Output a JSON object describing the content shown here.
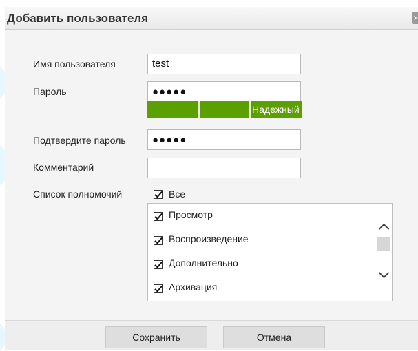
{
  "dialog": {
    "title": "Добавить пользователя",
    "close_glyph": "×"
  },
  "form": {
    "username_label": "Имя пользователя",
    "username_value": "test",
    "password_label": "Пароль",
    "password_value": "●●●●●",
    "strength_label": "Надежный",
    "strength_level": "3/3",
    "confirm_label": "Подтвердите пароль",
    "confirm_value": "●●●●●",
    "comment_label": "Комментарий",
    "comment_value": "",
    "permissions_label": "Список полномочий",
    "all_label": "Все",
    "all_checked": true
  },
  "permissions": [
    {
      "label": "Просмотр",
      "checked": true
    },
    {
      "label": "Воспроизведение",
      "checked": true
    },
    {
      "label": "Дополнительно",
      "checked": true
    },
    {
      "label": "Архивация",
      "checked": true
    }
  ],
  "footer": {
    "save_label": "Сохранить",
    "cancel_label": "Отмена"
  },
  "colors": {
    "strength_bar": "#5ba000",
    "body_bg": "#f4f4f4"
  },
  "icons": {
    "checkbox": "checkbox-checked-icon",
    "scroll_up": "chevron-up-icon",
    "scroll_down": "chevron-down-icon",
    "close": "close-icon"
  }
}
